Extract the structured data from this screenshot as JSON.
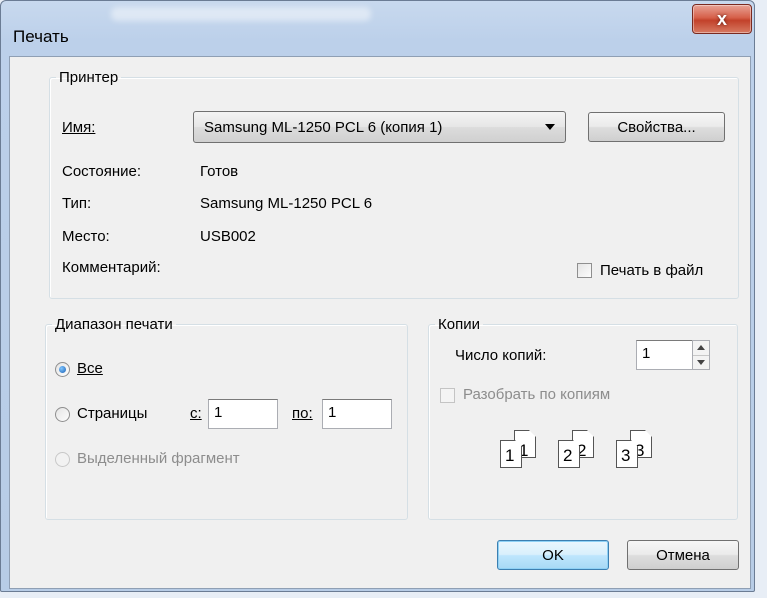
{
  "window": {
    "title": "Печать",
    "close_glyph": "x"
  },
  "printer": {
    "legend": "Принтер",
    "name_label": "Имя:",
    "name_value": "Samsung ML-1250 PCL 6 (копия 1)",
    "properties_label": "Свойства...",
    "status_label": "Состояние:",
    "status_value": "Готов",
    "type_label": "Тип:",
    "type_value": "Samsung ML-1250 PCL 6",
    "location_label": "Место:",
    "location_value": "USB002",
    "comment_label": "Комментарий:",
    "print_to_file_label": "Печать в файл",
    "print_to_file_checked": false
  },
  "range": {
    "legend": "Диапазон печати",
    "all_label": "Все",
    "pages_label": "Страницы",
    "from_label": "с:",
    "from_value": "1",
    "to_label": "по:",
    "to_value": "1",
    "selection_label": "Выделенный фрагмент",
    "selected": "all"
  },
  "copies": {
    "legend": "Копии",
    "count_label": "Число копий:",
    "count_value": "1",
    "collate_label": "Разобрать по копиям",
    "collate_checked": false,
    "collate_icon_digits": [
      "1",
      "1",
      "2",
      "2",
      "3",
      "3"
    ]
  },
  "buttons": {
    "ok_label": "OK",
    "cancel_label": "Отмена"
  },
  "colors": {
    "frame": "#bcd0ea",
    "close_button": "#c2412a",
    "default_button_border": "#3c7fb1",
    "dialog_face": "#f0f0f0"
  }
}
